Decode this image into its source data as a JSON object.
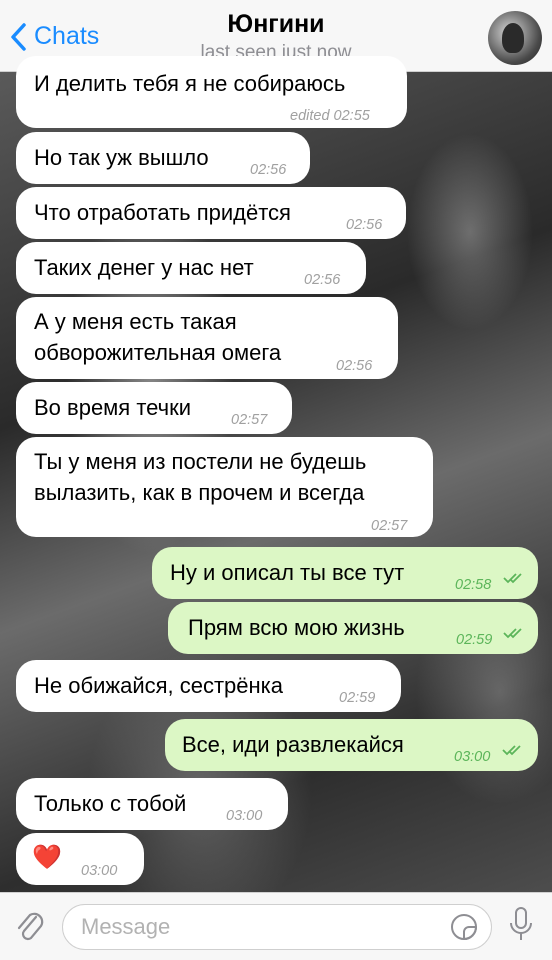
{
  "header": {
    "back_label": "Chats",
    "contact_name": "Юнгини",
    "status": "last seen just now"
  },
  "messages": [
    {
      "dir": "in",
      "text": "И делить тебя я не собираюсь",
      "time": "edited 02:55"
    },
    {
      "dir": "in",
      "text": "Но так уж вышло",
      "time": "02:56"
    },
    {
      "dir": "in",
      "text": "Что отработать придётся",
      "time": "02:56"
    },
    {
      "dir": "in",
      "text": "Таких денег у нас нет",
      "time": "02:56"
    },
    {
      "dir": "in",
      "line1": "А у меня есть такая",
      "line2": "обворожительная омега",
      "time": "02:56"
    },
    {
      "dir": "in",
      "text": "Во время течки",
      "time": "02:57"
    },
    {
      "dir": "in",
      "line1": "Ты у меня из постели не будешь",
      "line2": "вылазить, как в прочем и всегда",
      "time": "02:57"
    },
    {
      "dir": "out",
      "text": "Ну и описал ты все тут",
      "time": "02:58",
      "status": "read"
    },
    {
      "dir": "out",
      "text": "Прям всю мою жизнь",
      "time": "02:59",
      "status": "read"
    },
    {
      "dir": "in",
      "text": "Не обижайся, сестрёнка",
      "time": "02:59"
    },
    {
      "dir": "out",
      "text": "Все, иди развлекайся",
      "time": "03:00",
      "status": "read"
    },
    {
      "dir": "in",
      "text": "Только с тобой",
      "time": "03:00"
    },
    {
      "dir": "in",
      "text": "❤️",
      "time": "03:00"
    }
  ],
  "composer": {
    "placeholder": "Message",
    "attach_icon": "paperclip-icon",
    "sticker_icon": "sticker-icon",
    "mic_icon": "microphone-icon"
  },
  "colors": {
    "accent": "#1a8cff",
    "outgoing_bubble": "#dcf7c5",
    "incoming_bubble": "#ffffff",
    "outgoing_time": "#5cb55a"
  }
}
